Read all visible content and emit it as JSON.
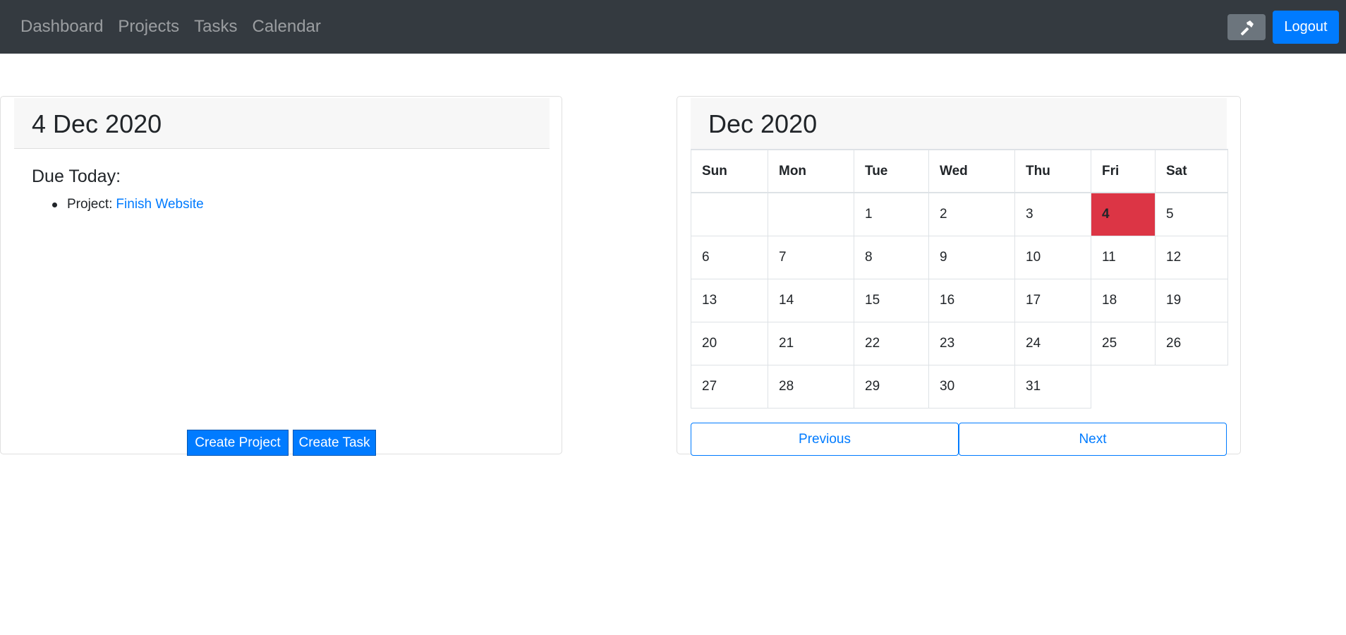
{
  "nav": {
    "links": [
      "Dashboard",
      "Projects",
      "Tasks",
      "Calendar"
    ],
    "tool_icon": "hammer-icon",
    "logout_label": "Logout"
  },
  "left_card": {
    "date_title": "4 Dec 2020",
    "due_title": "Due Today:",
    "due_items": [
      {
        "prefix": "Project:",
        "link": "Finish Website"
      }
    ],
    "create_project_label": "Create Project",
    "create_task_label": "Create Task"
  },
  "calendar": {
    "title": "Dec 2020",
    "weekdays": [
      "Sun",
      "Mon",
      "Tue",
      "Wed",
      "Thu",
      "Fri",
      "Sat"
    ],
    "weeks": [
      [
        "",
        "",
        "1",
        "2",
        "3",
        "4",
        "5"
      ],
      [
        "6",
        "7",
        "8",
        "9",
        "10",
        "11",
        "12"
      ],
      [
        "13",
        "14",
        "15",
        "16",
        "17",
        "18",
        "19"
      ],
      [
        "20",
        "21",
        "22",
        "23",
        "24",
        "25",
        "26"
      ],
      [
        "27",
        "28",
        "29",
        "30",
        "31",
        "",
        ""
      ]
    ],
    "today": "4",
    "today_color": "#dc3545",
    "previous_label": "Previous",
    "next_label": "Next"
  },
  "colors": {
    "navbar": "#343a40",
    "primary": "#007bff",
    "secondary": "#6c757d"
  }
}
